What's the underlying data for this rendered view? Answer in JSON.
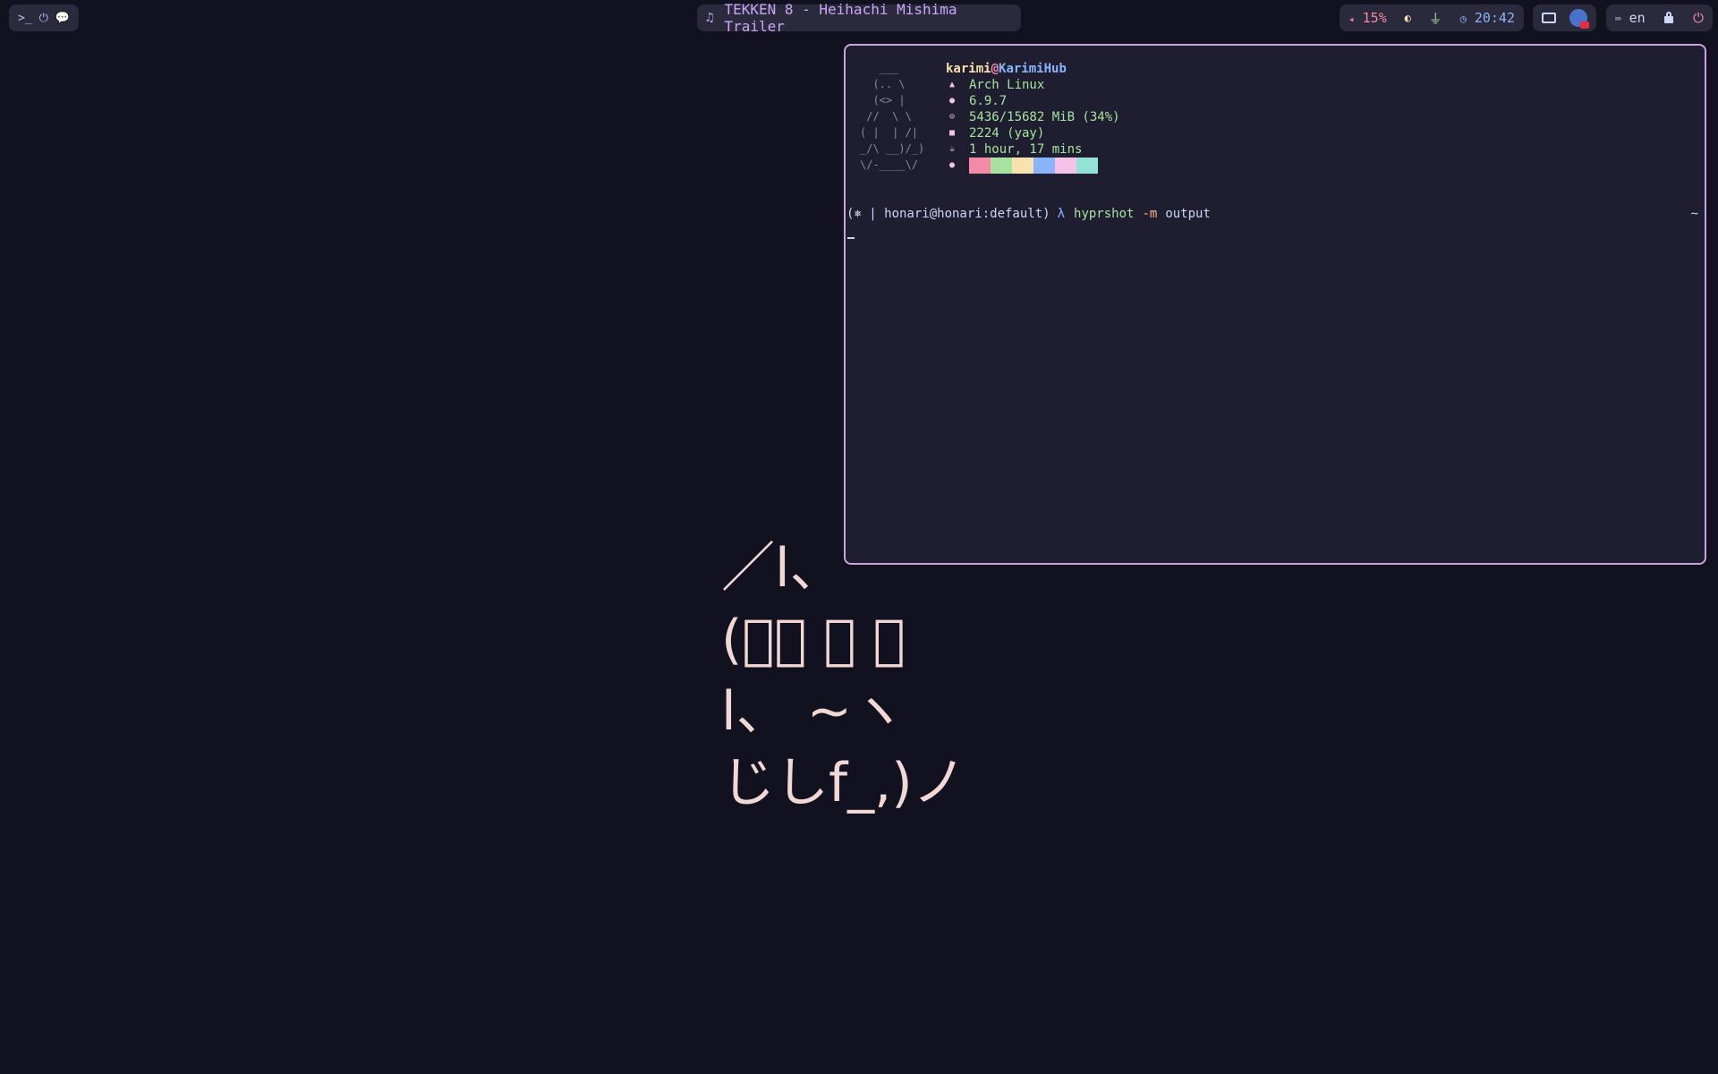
{
  "bar": {
    "left_icons": [
      "terminal-icon",
      "power-icon",
      "chat-icon"
    ],
    "left_glyphs": [
      ">_",
      "⏻",
      "💬"
    ],
    "media": {
      "icon": "music-note-icon",
      "glyph": "♫",
      "title": "TEKKEN 8 - Heihachi Mishima Trailer"
    },
    "volume": {
      "icon": "volume-icon",
      "glyph": "◂",
      "value": "15%"
    },
    "brightness_glyph": "◐",
    "power_plug_glyph": "⏚",
    "clock": {
      "icon": "clock-icon",
      "glyph": "◷",
      "time": "20:42"
    },
    "keyboard": {
      "glyph": "⌨",
      "layout": "en"
    },
    "power_glyph": "⏻"
  },
  "terminal": {
    "logo": [
      "   ___",
      "  (.. \\",
      "  (<> |",
      " //  \\ \\",
      "( |  | /|",
      "_/\\ __)/_)",
      "\\/-____\\/"
    ],
    "user": "karimi",
    "at": "@",
    "host": "KarimiHub",
    "info": [
      {
        "icon": "arch-icon",
        "glyph": "▲",
        "value": "Arch Linux"
      },
      {
        "icon": "kernel-icon",
        "glyph": "●",
        "value": "6.9.7"
      },
      {
        "icon": "memory-icon",
        "glyph": "⊙",
        "value": "5436/15682 MiB (34%)"
      },
      {
        "icon": "package-icon",
        "glyph": "■",
        "value": "2224 (yay)"
      },
      {
        "icon": "uptime-icon",
        "glyph": "☕",
        "value": "1 hour, 17 mins"
      },
      {
        "icon": "palette-icon",
        "glyph": "●",
        "value": ""
      }
    ],
    "palette": [
      "#f38ba8",
      "#a6e3a1",
      "#f9e2af",
      "#89b4fa",
      "#f5c2e7",
      "#94e2d5"
    ],
    "prompt": {
      "prefix": "(⎈ | honari@honari:default)",
      "lambda": "λ",
      "command": "hyprshot",
      "flag": "-m",
      "arg": "output",
      "dir": "~"
    }
  },
  "kaomoji": "／l、\n(ﾟ､ ｡ ７\nl、 ~ヽ\nじしf_,)ノ"
}
